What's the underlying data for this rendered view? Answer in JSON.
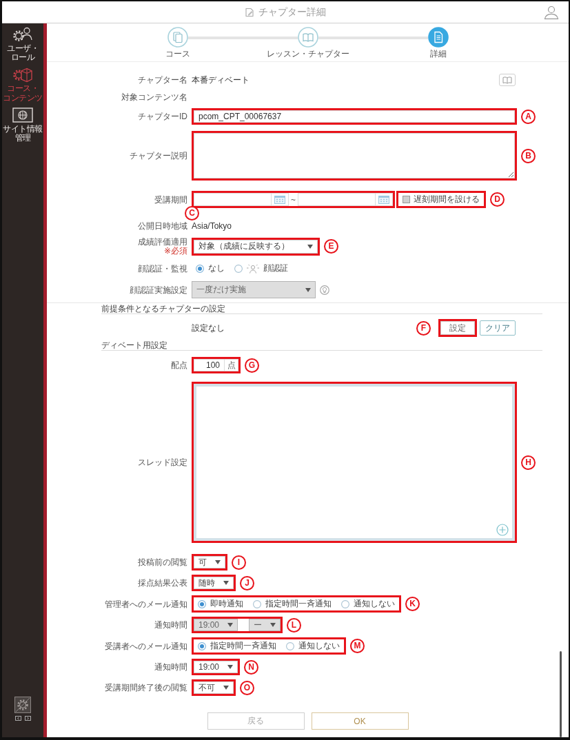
{
  "header": {
    "title": "チャプター詳細"
  },
  "sidebar": {
    "items": [
      {
        "label": "ユーザ・ロール",
        "selected": false
      },
      {
        "label": "コース・コンテンツ",
        "selected": true
      },
      {
        "label": "サイト情報管理",
        "selected": false
      }
    ]
  },
  "stepper": {
    "steps": [
      {
        "label": "コース",
        "selected": false
      },
      {
        "label": "レッスン・チャプター",
        "selected": false
      },
      {
        "label": "詳細",
        "selected": true
      }
    ]
  },
  "sections": [
    {
      "rows": [
        {
          "kind": "name",
          "label": "チャプター名",
          "value": "本番ディベート"
        },
        {
          "kind": "text",
          "label": "対象コンテンツ名"
        },
        {
          "kind": "input",
          "label": "チャプターID",
          "value": "pcom_CPT_00067637",
          "callout": "A"
        },
        {
          "kind": "textarea",
          "label": "チャプター説明",
          "callout": "B"
        },
        {
          "kind": "period",
          "label": "受講期間",
          "separator": "~",
          "callout": "C",
          "checkbox": {
            "label": "遅刻期間を設ける",
            "checked": false,
            "callout": "D"
          }
        },
        {
          "kind": "text",
          "label": "公開日時地域",
          "value": "Asia/Tokyo"
        },
        {
          "kind": "select",
          "label": "成績評価適用",
          "note": "※必須",
          "value": "対象（成績に反映する）",
          "disabled": false,
          "callout": "E"
        },
        {
          "kind": "radio",
          "label": "顔認証・監視",
          "options": [
            {
              "kind": "plain",
              "label": "なし",
              "selected": true
            },
            {
              "kind": "face",
              "label": "顔認証",
              "selected": false
            }
          ]
        },
        {
          "kind": "select",
          "label": "顔認証実施設定",
          "value": "一度だけ実施",
          "disabled": true,
          "help": true
        }
      ]
    },
    {
      "title": "前提条件となるチャプターの設定",
      "rows": [
        {
          "kind": "buttons",
          "value": "設定なし",
          "buttons": [
            {
              "label": "設定",
              "callout": "F"
            },
            {
              "label": "クリア"
            }
          ]
        }
      ]
    },
    {
      "title": "ディベート用設定",
      "rows": [
        {
          "kind": "number",
          "label": "配点",
          "value": "100",
          "unit": "点",
          "callout": "G"
        },
        {
          "kind": "thread",
          "label": "スレッド設定",
          "callout": "H"
        },
        {
          "kind": "select",
          "label": "投稿前の閲覧",
          "value": "可",
          "disabled": false,
          "callout": "I"
        },
        {
          "kind": "select",
          "label": "採点結果公表",
          "value": "随時",
          "disabled": false,
          "callout": "J"
        },
        {
          "kind": "radio",
          "label": "管理者へのメール通知",
          "options": [
            {
              "kind": "plain",
              "label": "即時通知",
              "selected": true
            },
            {
              "kind": "plain",
              "label": "指定時間一斉通知",
              "selected": false
            },
            {
              "kind": "plain",
              "label": "通知しない",
              "selected": false
            }
          ],
          "callout": "K"
        },
        {
          "kind": "selects",
          "label": "通知時間",
          "values": [
            "19:00",
            "ー"
          ],
          "disabled": true,
          "callout": "L"
        },
        {
          "kind": "radio",
          "label": "受講者へのメール通知",
          "options": [
            {
              "kind": "plain",
              "label": "指定時間一斉通知",
              "selected": true
            },
            {
              "kind": "plain",
              "label": "通知しない",
              "selected": false
            }
          ],
          "callout": "M"
        },
        {
          "kind": "select",
          "label": "通知時間",
          "value": "19:00",
          "disabled": false,
          "callout": "N"
        },
        {
          "kind": "select",
          "label": "受講期間終了後の閲覧",
          "value": "不可",
          "disabled": false,
          "callout": "O"
        }
      ]
    }
  ],
  "footer": {
    "buttons": [
      {
        "label": "戻る",
        "disabled": true
      },
      {
        "label": "OK",
        "disabled": false
      }
    ]
  }
}
